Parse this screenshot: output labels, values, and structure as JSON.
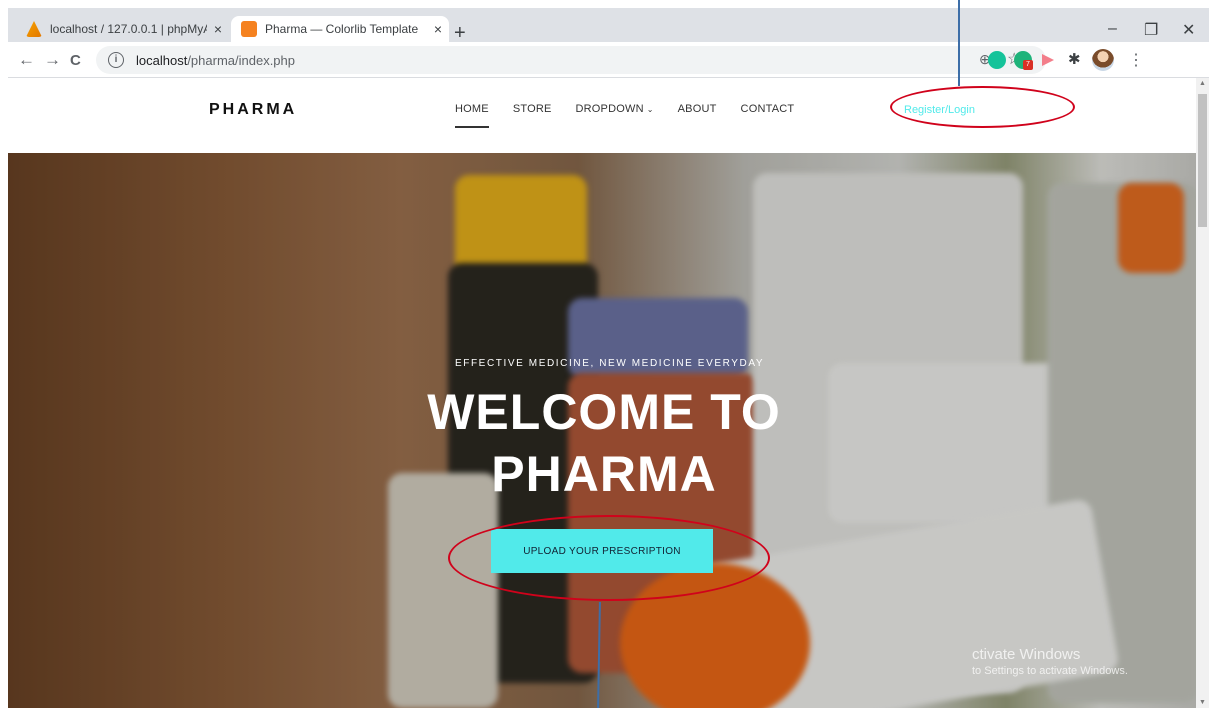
{
  "browser": {
    "tabs": [
      {
        "title": "localhost / 127.0.0.1 | phpMyAdn",
        "close": "×",
        "icon": "phpmyadmin-favicon"
      },
      {
        "title": "Pharma — Colorlib Template",
        "close": "×",
        "icon": "colorlib-favicon"
      }
    ],
    "new_tab": "+",
    "window_controls": {
      "minimize": "–",
      "restore": "❐",
      "close": "✕"
    },
    "nav": {
      "back": "←",
      "forward": "→",
      "reload": "C"
    },
    "address": {
      "info": "i",
      "host": "localhost",
      "path": "/pharma/index.php"
    },
    "right_icons": {
      "zoom": "⊕",
      "star": "☆",
      "puzzle": "✱",
      "menu": "⋮"
    },
    "ext_badge": "7"
  },
  "site": {
    "logo": "PHARMA",
    "nav": [
      {
        "label": "HOME",
        "active": true
      },
      {
        "label": "STORE"
      },
      {
        "label": "DROPDOWN",
        "caret": "⌄"
      },
      {
        "label": "ABOUT"
      },
      {
        "label": "CONTACT"
      }
    ],
    "auth_link": "Register/Login",
    "accent": "#51eaea"
  },
  "hero": {
    "tagline": "EFFECTIVE MEDICINE, NEW MEDICINE EVERYDAY",
    "title_line1": "WELCOME TO",
    "title_line2": "PHARMA",
    "cta": "UPLOAD YOUR PRESCRIPTION"
  },
  "watermark": {
    "line1": "ctivate Windows",
    "line2": "to Settings to activate Windows."
  },
  "scrollbar": {
    "up": "▲",
    "down": "▼"
  },
  "annotation_color": "#d0021b"
}
